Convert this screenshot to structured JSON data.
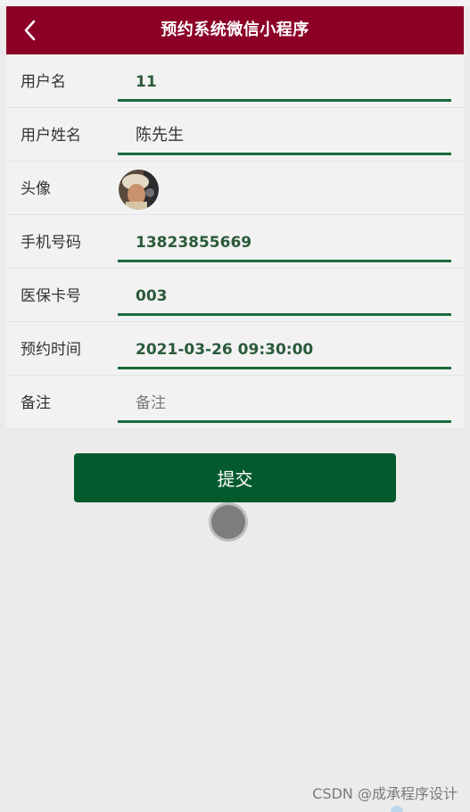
{
  "header": {
    "title": "预约系统微信小程序",
    "back_icon": "chevron-left-icon",
    "background_color": "#8c0027"
  },
  "form": {
    "fields": [
      {
        "label": "用户名",
        "value": "11"
      },
      {
        "label": "用户姓名",
        "value": "陈先生"
      },
      {
        "label": "头像",
        "value": "",
        "icon": "avatar-photo"
      },
      {
        "label": "手机号码",
        "value": "13823855669"
      },
      {
        "label": "医保卡号",
        "value": "003"
      },
      {
        "label": "预约时间",
        "value": "2021-03-26 09:30:00"
      },
      {
        "label": "备注",
        "placeholder": "备注"
      }
    ],
    "underline_color": "#1a6a3a"
  },
  "submit": {
    "label": "提交",
    "color": "#035a2c"
  },
  "watermark": "CSDN @成承程序设计"
}
